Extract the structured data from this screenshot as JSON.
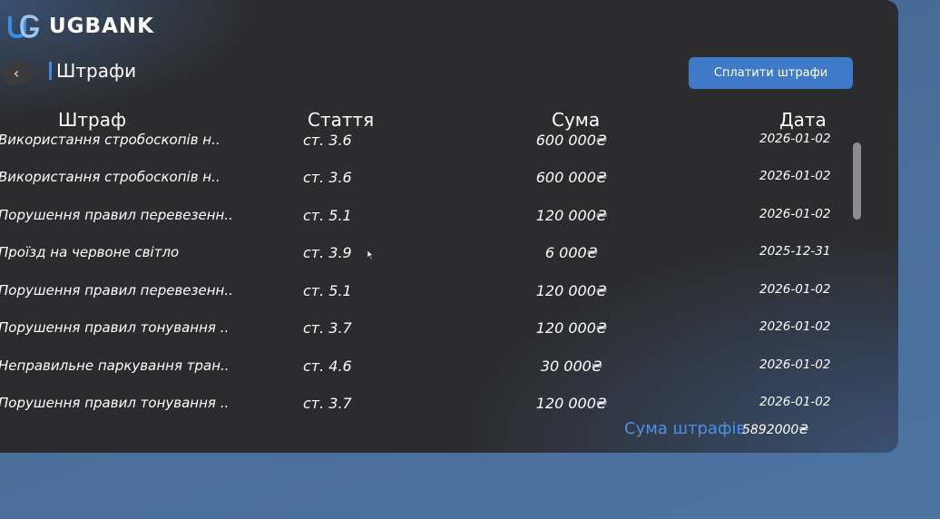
{
  "brand": {
    "name": "UGBANK",
    "logo_icon": "ug-logo-icon"
  },
  "header": {
    "title": "Штрафи",
    "back_icon": "chevron-left-icon",
    "back_glyph": "‹"
  },
  "actions": {
    "pay_label": "Сплатити штрафи"
  },
  "table": {
    "columns": [
      "Штраф",
      "Стаття",
      "Сума",
      "Дата"
    ],
    "rows": [
      {
        "name": "Використання стробоскопів н..",
        "article": "ст. 3.6",
        "amount": "600 000₴",
        "date": "2026-01-02"
      },
      {
        "name": "Використання стробоскопів н..",
        "article": "ст. 3.6",
        "amount": "600 000₴",
        "date": "2026-01-02"
      },
      {
        "name": "Порушення правил перевезенн..",
        "article": "ст. 5.1",
        "amount": "120 000₴",
        "date": "2026-01-02"
      },
      {
        "name": "Проїзд на червоне світло",
        "article": "ст. 3.9",
        "amount": "6 000₴",
        "date": "2025-12-31"
      },
      {
        "name": "Порушення правил перевезенн..",
        "article": "ст. 5.1",
        "amount": "120 000₴",
        "date": "2026-01-02"
      },
      {
        "name": "Порушення правил тонування ..",
        "article": "ст. 3.7",
        "amount": "120 000₴",
        "date": "2026-01-02"
      },
      {
        "name": "Неправильне паркування тран..",
        "article": "ст. 4.6",
        "amount": "30 000₴",
        "date": "2026-01-02"
      },
      {
        "name": "Порушення правил тонування ..",
        "article": "ст. 3.7",
        "amount": "120 000₴",
        "date": "2026-01-02"
      }
    ]
  },
  "total": {
    "label": "Сума штрафів",
    "value": "5892000₴"
  },
  "colors": {
    "accent": "#3f79c8",
    "panel": "#2c2c2e",
    "background": "#4a6c99",
    "total_label": "#4a92e8"
  }
}
